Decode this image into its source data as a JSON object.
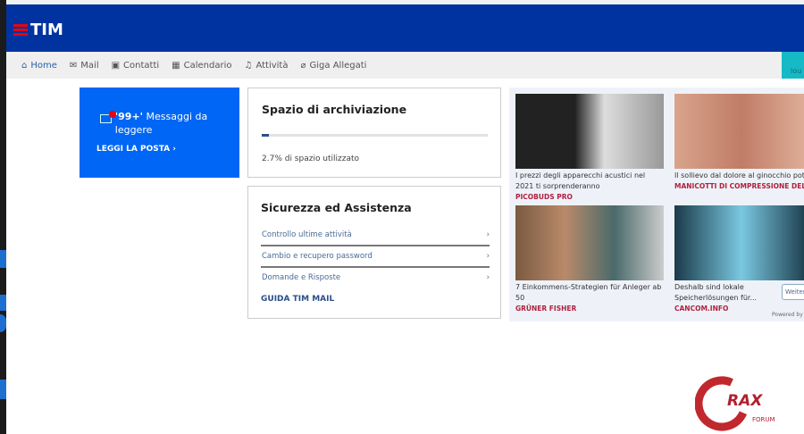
{
  "header": {
    "brand": "TIM"
  },
  "nav": {
    "items": [
      {
        "label": "Home",
        "icon": "home-icon"
      },
      {
        "label": "Mail",
        "icon": "mail-icon"
      },
      {
        "label": "Contatti",
        "icon": "contacts-icon"
      },
      {
        "label": "Calendario",
        "icon": "calendar-icon"
      },
      {
        "label": "Attività",
        "icon": "bell-icon"
      },
      {
        "label": "Giga Allegati",
        "icon": "paperclip-icon"
      }
    ],
    "logout": "lou"
  },
  "mail": {
    "count": "'99+'",
    "text": " Messaggi da leggere",
    "action": "LEGGI LA POSTA"
  },
  "storage": {
    "title": "Spazio di archiviazione",
    "percent": 2.7,
    "text": "2.7% di spazio utilizzato"
  },
  "security": {
    "title": "Sicurezza ed Assistenza",
    "links": [
      "Controllo ultime attività",
      "Cambio e recupero password",
      "Domande e Risposte"
    ],
    "guide": "GUIDA TIM MAIL"
  },
  "ads": {
    "items": [
      {
        "title": "I prezzi degli apparecchi acustici nel 2021 ti sorprenderanno",
        "source": "PICOBUDS PRO"
      },
      {
        "title": "Il sollievo dal dolore al ginocchio potrebbe essere a un passo",
        "source": "MANICOTTI DI COMPRESSIONE DEL GIN"
      },
      {
        "title": "7 Einkommens-Strategien für Anleger ab 50",
        "source": "GRÜNER FISHER"
      },
      {
        "title": "Deshalb sind lokale Speicherlösungen für...",
        "source": "CANCOM.INFO"
      }
    ],
    "more": "Weiter",
    "powered": "Powered by"
  },
  "watermark": {
    "text": "CRAX FORUM"
  },
  "colors": {
    "header": "#0033a0",
    "accent": "#0066f5",
    "logout": "#16b9c6",
    "sponsor": "#b02040"
  }
}
